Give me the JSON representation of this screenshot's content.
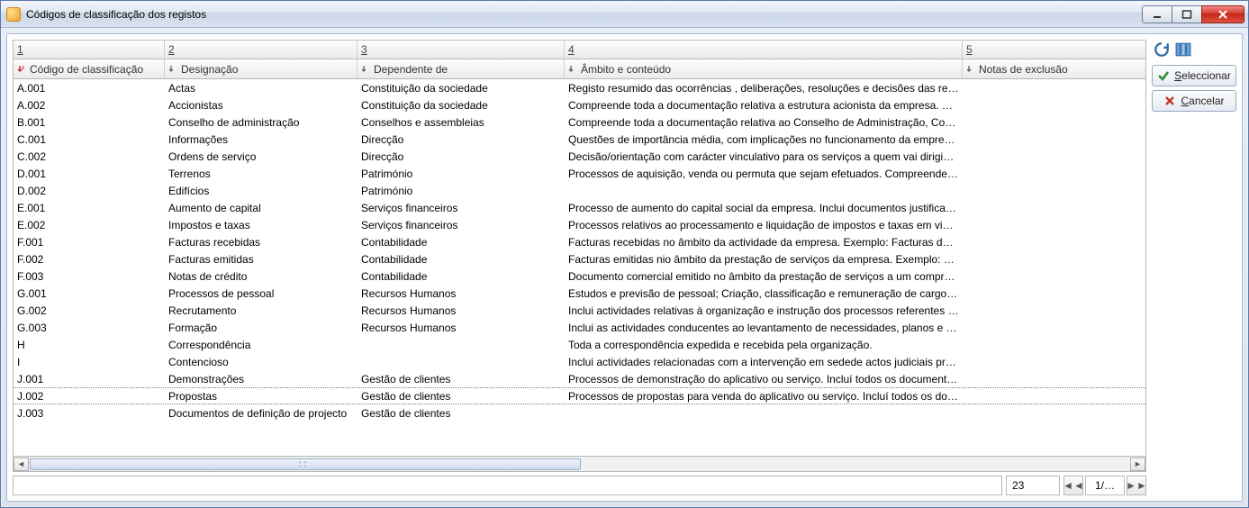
{
  "window": {
    "title": "Códigos de classificação dos registos"
  },
  "filters": [
    "1",
    "2",
    "3",
    "4",
    "5"
  ],
  "columns": {
    "code": "Código de classificação",
    "desig": "Designação",
    "dep": "Dependente de",
    "amb": "Âmbito e conteúdo",
    "notas": "Notas de exclusão"
  },
  "rows": [
    {
      "code": "A.001",
      "desig": "Actas",
      "dep": "Constituição da sociedade",
      "amb": "Registo resumido das ocorrências , deliberações, resoluções e decisões das reun…",
      "notas": ""
    },
    {
      "code": "A.002",
      "desig": "Accionistas",
      "dep": "Constituição da sociedade",
      "amb": "Compreende toda a documentação relativa a estrutura acionista da empresa. C…",
      "notas": ""
    },
    {
      "code": "B.001",
      "desig": "Conselho de administração",
      "dep": "Conselhos e assembleias",
      "amb": "Compreende toda a documentação relativa ao Conselho de Administração, Cor…",
      "notas": ""
    },
    {
      "code": "C.001",
      "desig": "Informações",
      "dep": "Direcção",
      "amb": "Questões de importância média, com implicações no funcionamento da empre…",
      "notas": ""
    },
    {
      "code": "C.002",
      "desig": "Ordens de serviço",
      "dep": "Direcção",
      "amb": "Decisão/orientação com carácter vinculativo para os serviços a quem vai dirigid…",
      "notas": ""
    },
    {
      "code": "D.001",
      "desig": "Terrenos",
      "dep": "Património",
      "amb": "Processos de aquisição, venda ou permuta que sejam efetuados. Compreende t…",
      "notas": ""
    },
    {
      "code": "D.002",
      "desig": "Edifícios",
      "dep": "Património",
      "amb": "",
      "notas": ""
    },
    {
      "code": "E.001",
      "desig": "Aumento de capital",
      "dep": "Serviços financeiros",
      "amb": "Processo de aumento do capital social da empresa. Inclui documentos justificat…",
      "notas": ""
    },
    {
      "code": "E.002",
      "desig": "Impostos e taxas",
      "dep": "Serviços financeiros",
      "amb": "Processos relativos ao processamento e liquidação de impostos e taxas em vigo…",
      "notas": ""
    },
    {
      "code": "F.001",
      "desig": "Facturas recebidas",
      "dep": "Contabilidade",
      "amb": "Facturas recebidas no âmbito da actividade da empresa. Exemplo: Facturas de f…",
      "notas": ""
    },
    {
      "code": "F.002",
      "desig": "Facturas emitidas",
      "dep": "Contabilidade",
      "amb": "Facturas emitidas nio âmbito da prestação de serviços da empresa. Exemplo: Fa…",
      "notas": ""
    },
    {
      "code": "F.003",
      "desig": "Notas de crédito",
      "dep": "Contabilidade",
      "amb": "Documento comercial emitido no âmbito da prestação de serviços a um compr…",
      "notas": ""
    },
    {
      "code": "G.001",
      "desig": "Processos de pessoal",
      "dep": "Recursos Humanos",
      "amb": "Estudos e previsão de pessoal; Criação, classificação e remuneração de cargos e …",
      "notas": ""
    },
    {
      "code": "G.002",
      "desig": "Recrutamento",
      "dep": "Recursos Humanos",
      "amb": "Inclui actividades relativas à organização e instrução dos processos referentes a…",
      "notas": ""
    },
    {
      "code": "G.003",
      "desig": "Formação",
      "dep": "Recursos Humanos",
      "amb": "Inclui as actividades conducentes ao levantamento de necessidades, planos e ac…",
      "notas": ""
    },
    {
      "code": "H",
      "desig": "Correspondência",
      "dep": "",
      "amb": "Toda a correspondência expedida e recebida pela organização.",
      "notas": ""
    },
    {
      "code": "I",
      "desig": "Contencioso",
      "dep": "",
      "amb": "Inclui actividades relacionadas com a intervenção em sedede actos judiciais pre…",
      "notas": ""
    },
    {
      "code": "J.001",
      "desig": "Demonstrações",
      "dep": "Gestão de clientes",
      "amb": "Processos de demonstração do aplicativo ou serviço. Incluí todos os document…",
      "notas": ""
    },
    {
      "code": "J.002",
      "desig": "Propostas",
      "dep": "Gestão de clientes",
      "amb": "Processos de propostas para venda do aplicativo ou serviço. Incluí todos os doc…",
      "notas": ""
    },
    {
      "code": "J.003",
      "desig": "Documentos de definição de projecto",
      "dep": "Gestão de clientes",
      "amb": "",
      "notas": ""
    }
  ],
  "selected_index": 18,
  "status": {
    "count": "23",
    "page": "1/…"
  },
  "buttons": {
    "select": "Seleccionar",
    "cancel": "Cancelar"
  }
}
